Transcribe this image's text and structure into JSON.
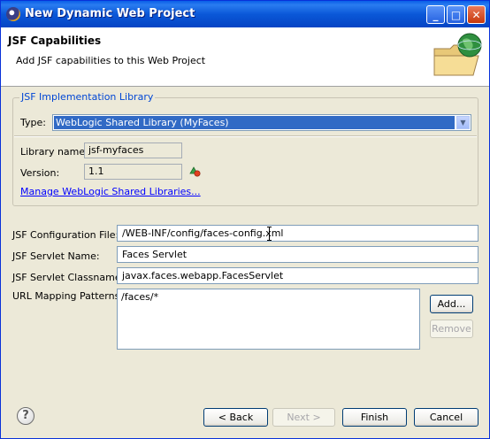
{
  "window": {
    "title": "New Dynamic Web Project"
  },
  "header": {
    "title": "JSF Capabilities",
    "description": "Add JSF capabilities to this Web Project"
  },
  "impl_group": {
    "legend": "JSF Implementation Library",
    "type_label": "Type:",
    "type_value": "WebLogic Shared Library (MyFaces)",
    "library_name_label": "Library name:",
    "library_name_value": "jsf-myfaces",
    "version_label": "Version:",
    "version_value": "1.1",
    "manage_link": "Manage WebLogic Shared Libraries..."
  },
  "config": {
    "config_file_label": "JSF Configuration File:",
    "config_file_value": "/WEB-INF/config/faces-config.xml",
    "servlet_name_label": "JSF Servlet Name:",
    "servlet_name_value": "Faces Servlet",
    "servlet_class_label": "JSF Servlet Classname:",
    "servlet_class_value": "javax.faces.webapp.FacesServlet",
    "url_patterns_label": "URL Mapping Patterns:",
    "url_patterns": [
      "/faces/*"
    ],
    "add_button": "Add...",
    "remove_button": "Remove"
  },
  "footer": {
    "help_symbol": "?",
    "back_button": "< Back",
    "next_button": "Next >",
    "finish_button": "Finish",
    "cancel_button": "Cancel"
  },
  "colors": {
    "title_bar": "#0a58d8",
    "selection": "#316ac5",
    "legend": "#0046d5",
    "link": "#0000ff"
  }
}
